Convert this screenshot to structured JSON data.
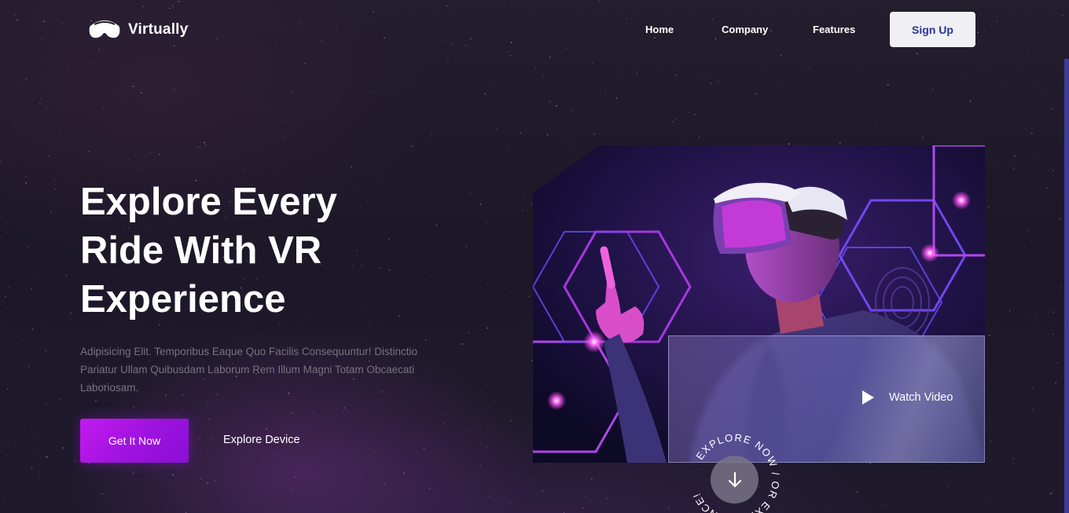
{
  "brand": {
    "name": "Virtually"
  },
  "nav": {
    "links": [
      "Home",
      "Company",
      "Features"
    ],
    "signup_label": "Sign Up"
  },
  "hero": {
    "title_lines": [
      "Explore Every",
      "Ride With VR",
      "Experience"
    ],
    "description": "Adipisicing Elit. Temporibus Eaque Quo Facilis Consequuntur! Distinctio Pariatur Ullam Quibusdam Laborum Rem Illum Magni Totam Obcaecati Laboriosam.",
    "primary_button": "Get It Now",
    "secondary_link": "Explore Device"
  },
  "video": {
    "label": "Watch Video"
  },
  "scroll_badge": {
    "circular_text": "EXPLORE NOW / OR EXPERIENCE!"
  },
  "colors": {
    "accent": "#b318ea",
    "signup_text": "#2b3398",
    "background": "#1c1827"
  },
  "icons": {
    "logo": "vr-headset-icon",
    "play": "play-icon",
    "scroll": "arrow-down-icon"
  }
}
